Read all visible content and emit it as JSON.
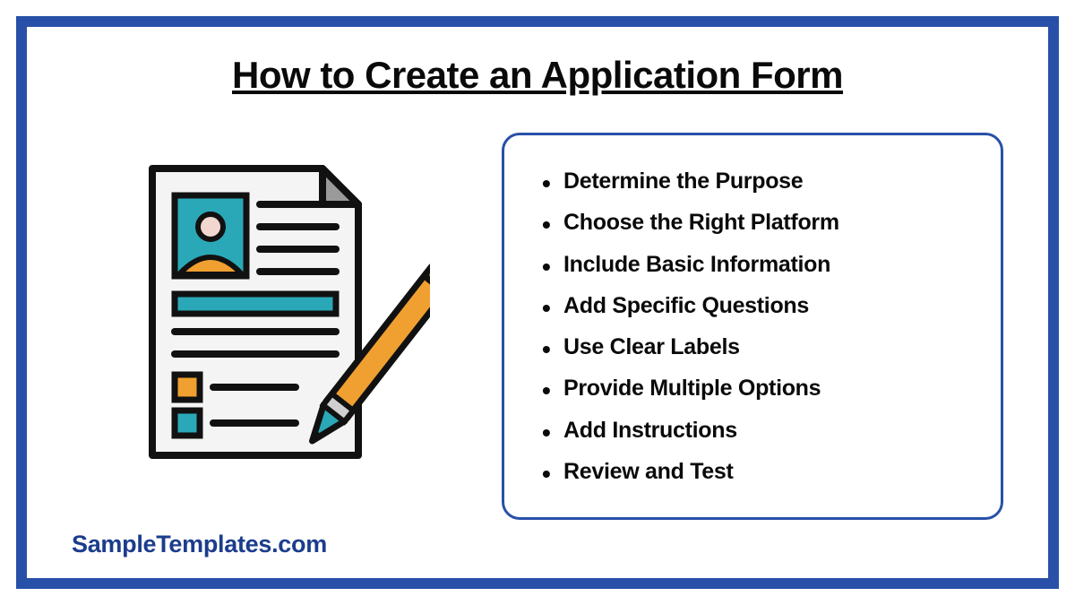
{
  "title": "How to Create an Application Form",
  "steps": [
    "Determine the Purpose",
    "Choose the Right Platform",
    "Include Basic Information",
    "Add Specific Questions",
    "Use Clear Labels",
    "Provide Multiple Options",
    "Add Instructions",
    "Review and Test"
  ],
  "brand": "SampleTemplates.com",
  "colors": {
    "frame": "#2850A8",
    "accent_teal": "#2BA8B8",
    "accent_orange": "#F0A030",
    "brand_text": "#1B3D8C"
  }
}
